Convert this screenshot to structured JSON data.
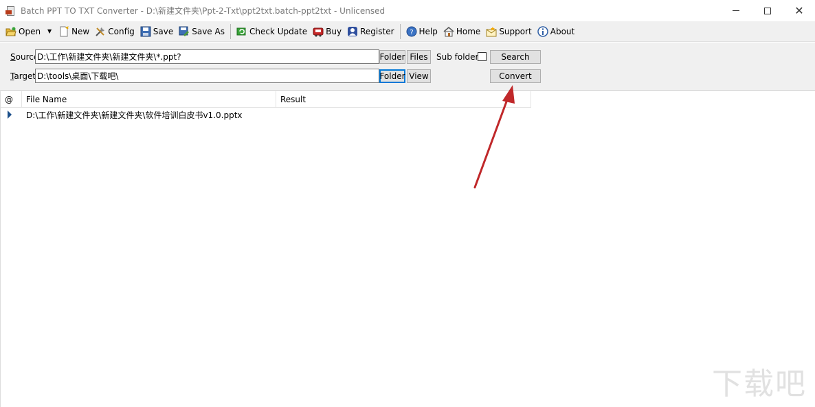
{
  "window": {
    "title": "Batch PPT TO TXT Converter - D:\\新建文件夹\\Ppt-2-Txt\\ppt2txt.batch-ppt2txt - Unlicensed",
    "close_glyph": "✕"
  },
  "toolbar": {
    "open": "Open",
    "new": "New",
    "config": "Config",
    "save": "Save",
    "save_as": "Save As",
    "check_update": "Check Update",
    "buy": "Buy",
    "register": "Register",
    "help": "Help",
    "home": "Home",
    "support": "Support",
    "about": "About",
    "dropdown_glyph": "▼"
  },
  "form": {
    "source_label_accel": "S",
    "source_label_rest": "ource",
    "source_value": "D:\\工作\\新建文件夹\\新建文件夹\\*.ppt?",
    "target_label_accel": "T",
    "target_label_rest": "arget",
    "target_value": "D:\\tools\\桌面\\下载吧\\",
    "folder_btn": "Folder",
    "files_btn": "Files",
    "view_btn": "View",
    "sub_folders": "Sub folders",
    "search_btn": "Search",
    "convert_btn": "Convert"
  },
  "grid": {
    "columns": [
      "@",
      "File Name",
      "Result"
    ],
    "rows": [
      {
        "file_name": "D:\\工作\\新建文件夹\\新建文件夹\\软件培训白皮书v1.0.pptx",
        "result": ""
      }
    ]
  },
  "watermark": {
    "text": "下载吧"
  },
  "colors": {
    "arrow": "#c0282a",
    "accent": "#0078d7",
    "row_indicator": "#1b4f8a"
  }
}
